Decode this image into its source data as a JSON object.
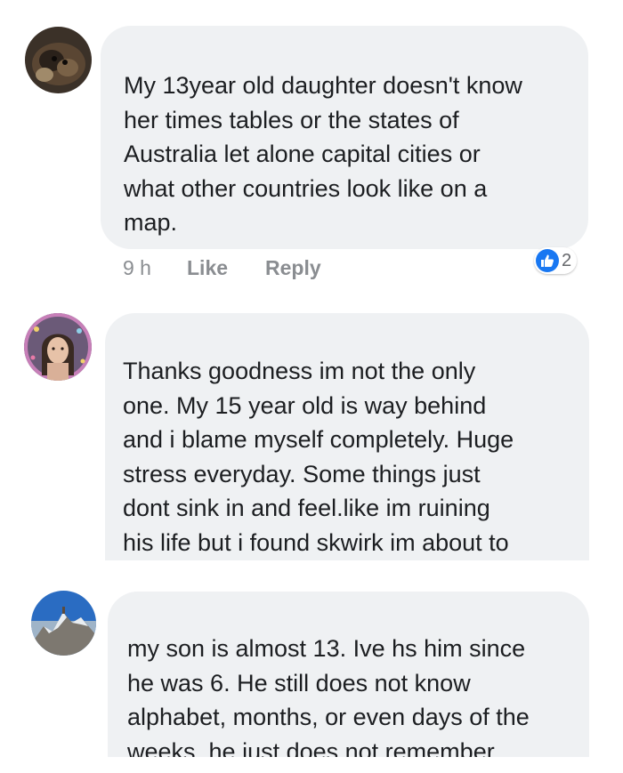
{
  "colors": {
    "bubble": "#eff1f3",
    "text": "#1c1e21",
    "meta": "#8a8d91",
    "like_blue": "#1877f2"
  },
  "comments": [
    {
      "avatar_icon": "dog-photo-avatar",
      "text": "My 13year old daughter doesn't know\nher times tables or the states of\nAustralia let alone capital cities or\nwhat other countries look like on a\nmap.",
      "time": "9 h",
      "like_label": "Like",
      "reply_label": "Reply",
      "reaction_icon": "thumbs-up-icon",
      "reaction_count": "2"
    },
    {
      "avatar_icon": "woman-photo-avatar",
      "text": "Thanks goodness im not the only\none. My 15 year old is way behind\nand i blame myself completely. Huge\nstress everyday. Some things just\ndont sink in and feel.like im ruining\nhis life but i found skwirk im about to"
    },
    {
      "avatar_icon": "mountain-photo-avatar",
      "text": "my son is almost 13. Ive hs him since\nhe was 6. He still does not know\nalphabet, months, or even days of the\nweeks, he just does not remember"
    }
  ]
}
